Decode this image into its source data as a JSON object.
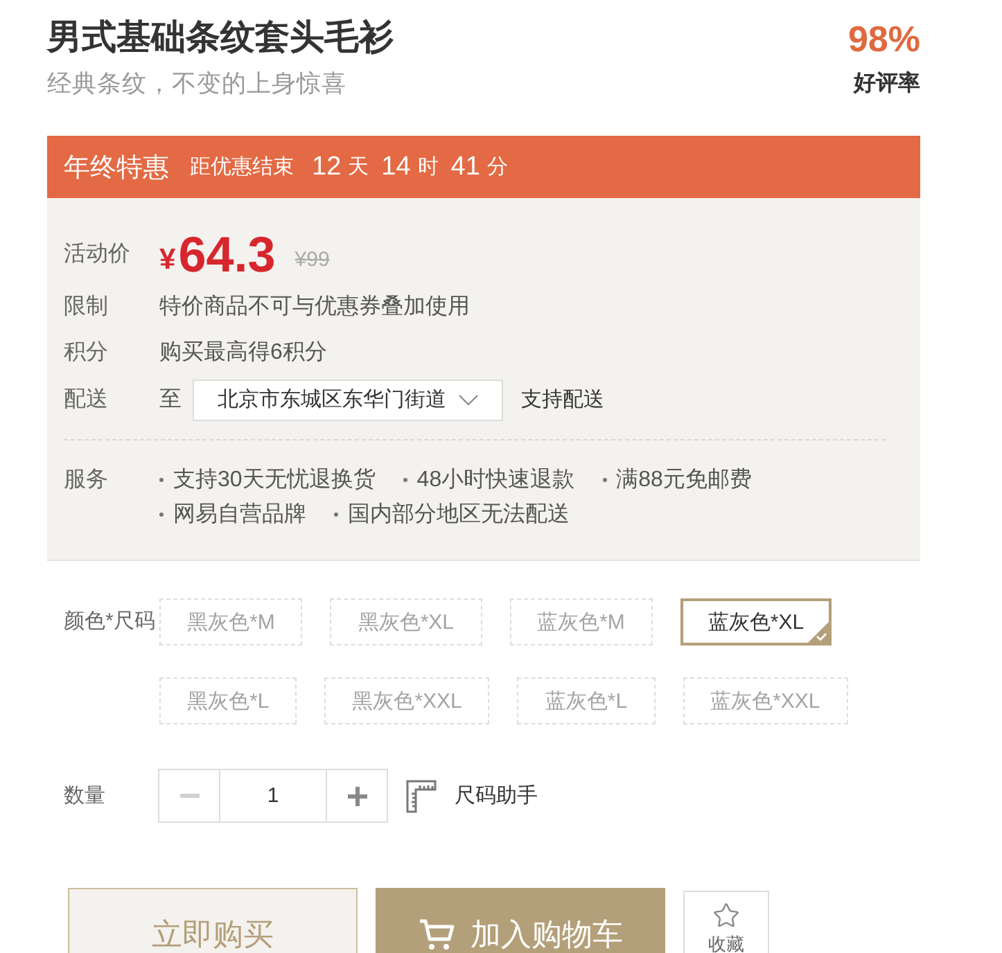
{
  "product": {
    "title": "男式基础条纹套头毛衫",
    "subtitle": "经典条纹，不变的上身惊喜"
  },
  "rating": {
    "value": "98%",
    "label": "好评率"
  },
  "promo_banner": {
    "title": "年终特惠",
    "countdown_label": "距优惠结束",
    "countdown": [
      {
        "value": "12",
        "unit": "天"
      },
      {
        "value": "14",
        "unit": "时"
      },
      {
        "value": "41",
        "unit": "分"
      }
    ]
  },
  "details": [
    {
      "kind": "price",
      "label": "活动价",
      "currency": "¥",
      "amount": "64.3",
      "original_price": "¥99"
    },
    {
      "kind": "text",
      "label": "限制",
      "text": "特价商品不可与优惠券叠加使用"
    },
    {
      "kind": "text",
      "label": "积分",
      "text": "购买最高得6积分"
    },
    {
      "kind": "delivery",
      "label": "配送",
      "prefix": "至",
      "location": "北京市东城区东华门街道",
      "note": "支持配送"
    }
  ],
  "services": {
    "label": "服务",
    "items": [
      "支持30天无忧退换货",
      "48小时快速退款",
      "满88元免邮费",
      "网易自营品牌",
      "国内部分地区无法配送"
    ]
  },
  "sku": {
    "label": "颜色*尺码",
    "options": [
      {
        "label": "黑灰色*M",
        "selected": false,
        "disabled": true
      },
      {
        "label": "黑灰色*XL",
        "selected": false,
        "disabled": true
      },
      {
        "label": "蓝灰色*M",
        "selected": false,
        "disabled": true
      },
      {
        "label": "蓝灰色*XL",
        "selected": true,
        "disabled": false
      },
      {
        "label": "黑灰色*L",
        "selected": false,
        "disabled": true
      },
      {
        "label": "黑灰色*XXL",
        "selected": false,
        "disabled": true
      },
      {
        "label": "蓝灰色*L",
        "selected": false,
        "disabled": true
      },
      {
        "label": "蓝灰色*XXL",
        "selected": false,
        "disabled": true
      }
    ]
  },
  "quantity": {
    "label": "数量",
    "value": "1",
    "decrement_disabled": true
  },
  "size_helper": {
    "label": "尺码助手"
  },
  "actions": [
    {
      "kind": "buy_now",
      "label": "立即购买"
    },
    {
      "kind": "add_to_cart",
      "label": "加入购物车"
    },
    {
      "kind": "favorite",
      "label": "收藏"
    }
  ]
}
